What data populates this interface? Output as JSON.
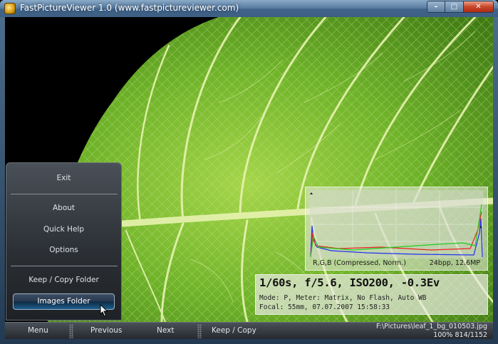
{
  "window": {
    "title": "FastPictureViewer 1.0 (www.fastpictureviewer.com)",
    "buttons": {
      "minimize": "–",
      "maximize": "□",
      "close": "✕"
    }
  },
  "menu": {
    "items": [
      "Exit",
      "About",
      "Quick Help",
      "Options",
      "Keep / Copy Folder"
    ],
    "active_button": "Images Folder"
  },
  "histogram": {
    "label": "R,G,B (Compressed, Norm.)",
    "meta": "24bpp, 12.6MP"
  },
  "exif": {
    "main": "1/60s, f/5.6, ISO200, -0.3Ev",
    "line1": "Mode: P, Meter: Matrix, No Flash, Auto WB",
    "line2": "Focal: 55mm, 07.07.2007 15:58:33"
  },
  "bottombar": {
    "menu": "Menu",
    "previous": "Previous",
    "next": "Next",
    "keep_copy": "Keep / Copy",
    "file_path": "F:\\Pictures\\leaf_1_bg_010503.jpg",
    "zoom": "100%",
    "position": "814/1152"
  },
  "colors": {
    "leaf": "#6fb32a",
    "vein": "#e8f3b0",
    "panel": "#2a2e33",
    "titlebar": "#5c7fa3"
  }
}
